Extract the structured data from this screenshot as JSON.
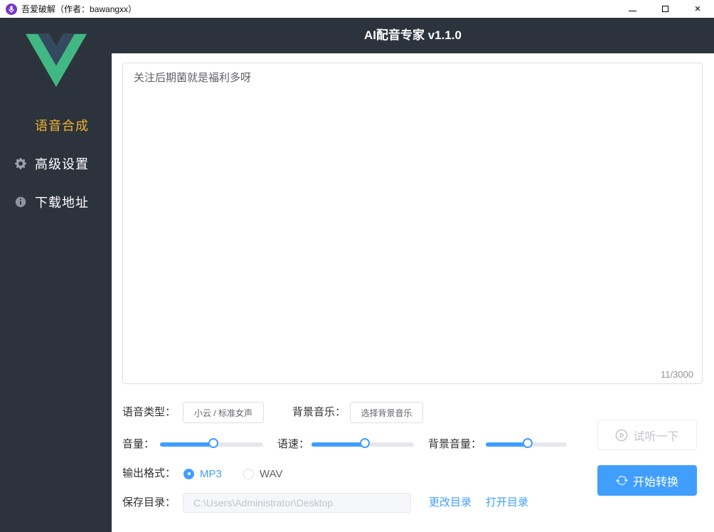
{
  "titlebar": {
    "app_title": "吾爱破解（作者：bawangxx）",
    "close_glyph": "×"
  },
  "header": {
    "title": "AI配音专家 v1.1.0"
  },
  "sidebar": {
    "items": [
      {
        "label": "语音合成",
        "icon": "grid-icon",
        "active": true
      },
      {
        "label": "高级设置",
        "icon": "gear-icon",
        "active": false
      },
      {
        "label": "下载地址",
        "icon": "info-icon",
        "active": false
      }
    ]
  },
  "editor": {
    "text": "关注后期菌就是福利多呀",
    "counter": "11/3000"
  },
  "voice_row": {
    "voice_type_label": "语音类型：",
    "voice_type_value": "小云 / 标准女声",
    "bg_music_label": "背景音乐：",
    "bg_music_button": "选择背景音乐"
  },
  "sliders": {
    "volume_label": "音量：",
    "volume_percent": 50,
    "speed_label": "语速：",
    "speed_percent": 51,
    "bg_volume_label": "背景音量：",
    "bg_volume_percent": 50
  },
  "format_row": {
    "label": "输出格式：",
    "options": [
      {
        "label": "MP3",
        "selected": true
      },
      {
        "label": "WAV",
        "selected": false
      }
    ]
  },
  "save_row": {
    "label": "保存目录：",
    "path": "C:\\Users\\Administrator\\Desktop",
    "change_link": "更改目录",
    "open_link": "打开目录"
  },
  "actions": {
    "preview": "试听一下",
    "convert": "开始转换"
  },
  "colors": {
    "primary_blue": "#409eff",
    "sidebar_dark": "#2c333d",
    "active_yellow": "#f0b32e",
    "vue_green": "#41b883",
    "vue_navy": "#35495e",
    "titlebar_icon_purple": "#7b34c8",
    "track_gray": "#e4e7ed"
  }
}
